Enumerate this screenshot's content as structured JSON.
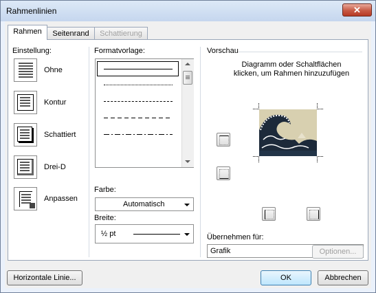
{
  "window": {
    "title": "Rahmenlinien",
    "close_glyph": "✕"
  },
  "tabs": [
    {
      "label": "Rahmen",
      "state": "active"
    },
    {
      "label": "Seitenrand",
      "state": "normal"
    },
    {
      "label": "Schattierung",
      "state": "disabled"
    }
  ],
  "settings": {
    "header": "Einstellung:",
    "items": [
      {
        "label": "Ohne",
        "icon": "none-border-icon"
      },
      {
        "label": "Kontur",
        "icon": "box-border-icon"
      },
      {
        "label": "Schattiert",
        "icon": "shadow-border-icon"
      },
      {
        "label": "Drei-D",
        "icon": "3d-border-icon"
      },
      {
        "label": "Anpassen",
        "icon": "custom-border-icon"
      }
    ]
  },
  "style": {
    "header": "Formatvorlage:",
    "line_styles": [
      "solid",
      "dotted",
      "dashed-fine",
      "dashed",
      "dash-dot"
    ],
    "selected_index": 0
  },
  "color": {
    "label": "Farbe:",
    "value": "Automatisch"
  },
  "width": {
    "label": "Breite:",
    "value": "½ pt"
  },
  "preview": {
    "header": "Vorschau",
    "instructions": "Diagramm oder Schaltflächen klicken, um Rahmen hinzuzufügen",
    "image_alt": "Grafik"
  },
  "apply_to": {
    "label": "Übernehmen für:",
    "value": "Grafik"
  },
  "buttons": {
    "options": "Optionen...",
    "horizontal_line": "Horizontale Linie...",
    "ok": "OK",
    "cancel": "Abbrechen"
  },
  "colors": {
    "title_bar": "#c5d6ee",
    "close_red": "#c75a45",
    "panel_bg": "#ffffff",
    "dialog_bg": "#f0f0f0"
  }
}
